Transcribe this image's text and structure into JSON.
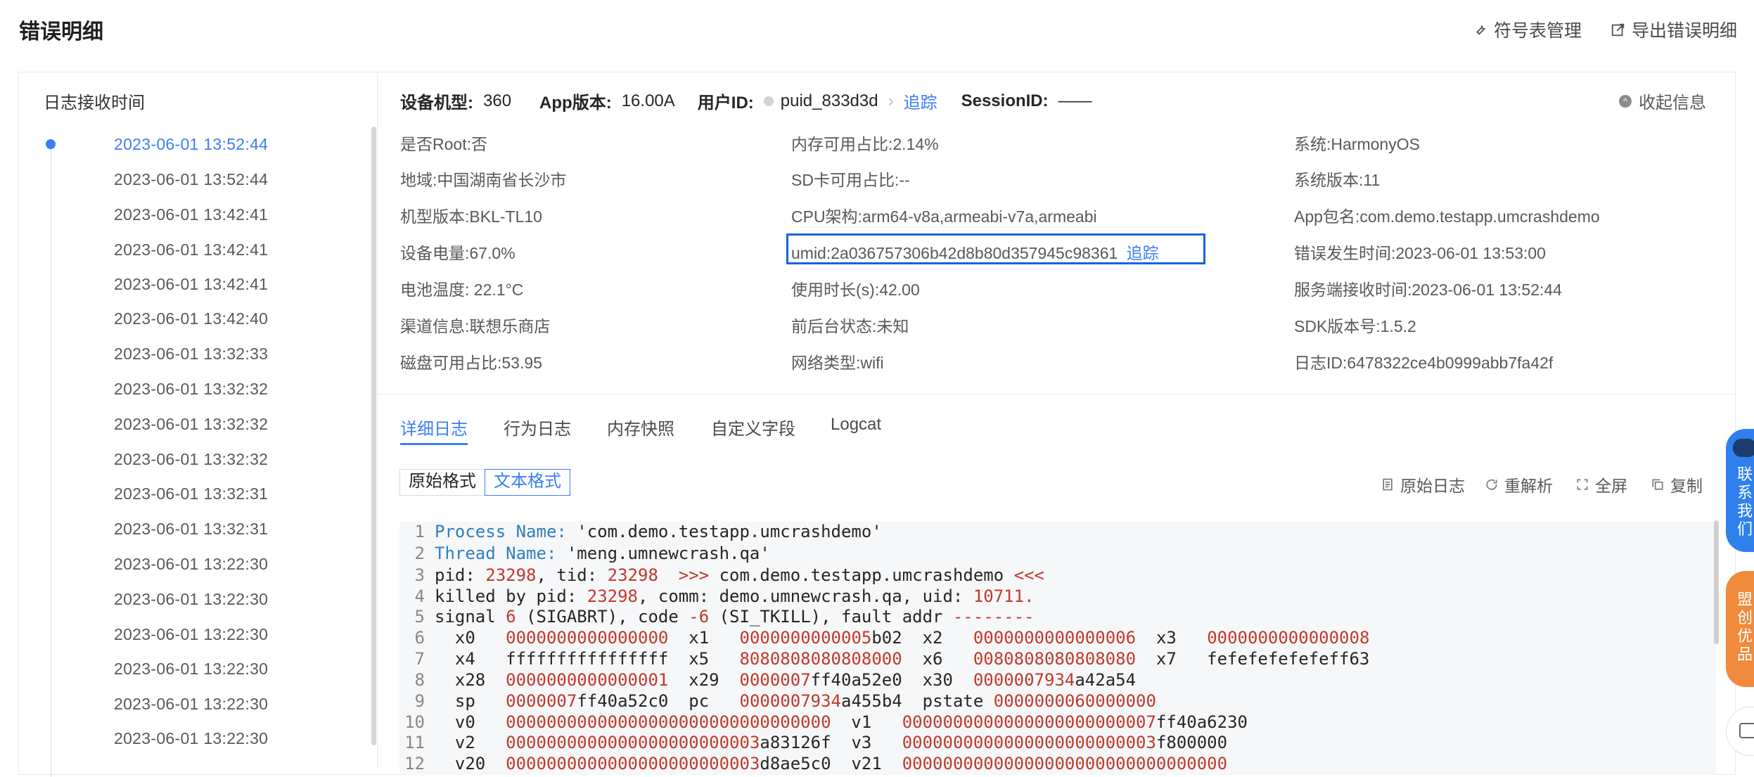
{
  "page": {
    "title": "错误明细",
    "symbol_mgmt": "符号表管理",
    "export": "导出错误明细"
  },
  "timeline": {
    "header": "日志接收时间",
    "items": [
      "2023-06-01 13:52:44",
      "2023-06-01 13:52:44",
      "2023-06-01 13:42:41",
      "2023-06-01 13:42:41",
      "2023-06-01 13:42:41",
      "2023-06-01 13:42:40",
      "2023-06-01 13:32:33",
      "2023-06-01 13:32:32",
      "2023-06-01 13:32:32",
      "2023-06-01 13:32:32",
      "2023-06-01 13:32:31",
      "2023-06-01 13:32:31",
      "2023-06-01 13:22:30",
      "2023-06-01 13:22:30",
      "2023-06-01 13:22:30",
      "2023-06-01 13:22:30",
      "2023-06-01 13:22:30",
      "2023-06-01 13:22:30"
    ]
  },
  "header": {
    "device_label": "设备机型:",
    "device_value": "360",
    "app_label": "App版本:",
    "app_value": "16.00A",
    "user_label": "用户ID:",
    "user_value": "puid_833d3d",
    "trace": "追踪",
    "session_label": "SessionID:",
    "session_value": "——",
    "collapse": "收起信息"
  },
  "info": {
    "col1": [
      "是否Root:否",
      "地域:中国湖南省长沙市",
      "机型版本:BKL-TL10",
      "设备电量:67.0%",
      "电池温度: 22.1°C",
      "渠道信息:联想乐商店",
      "磁盘可用占比:53.95"
    ],
    "col2": [
      "内存可用占比:2.14%",
      "SD卡可用占比:--",
      "CPU架构:arm64-v8a,armeabi-v7a,armeabi",
      "umid:2a036757306b42d8b80d357945c98361",
      "使用时长(s):42.00",
      "前后台状态:未知",
      "网络类型:wifi"
    ],
    "col3": [
      "系统:HarmonyOS",
      "系统版本:11",
      "App包名:com.demo.testapp.umcrashdemo",
      "错误发生时间:2023-06-01 13:53:00",
      "服务端接收时间:2023-06-01 13:52:44",
      "SDK版本号:1.5.2",
      "日志ID:6478322ce4b0999abb7fa42f"
    ],
    "umid_trace": "追踪"
  },
  "tabs": [
    "详细日志",
    "行为日志",
    "内存快照",
    "自定义字段",
    "Logcat"
  ],
  "format": {
    "raw": "原始格式",
    "text": "文本格式"
  },
  "tools": {
    "raw_log": "原始日志",
    "reparse": "重解析",
    "fullscreen": "全屏",
    "copy": "复制"
  },
  "code": {
    "line_numbers": [
      "1",
      "2",
      "3",
      "4",
      "5",
      "6",
      "7",
      "8",
      "9",
      "10",
      "11",
      "12"
    ],
    "l1": {
      "key": "Process Name:",
      "val": " 'com.demo.testapp.umcrashdemo'"
    },
    "l2": {
      "key": "Thread Name:",
      "val": " 'meng.umnewcrash.qa'"
    },
    "l3": {
      "a": "pid: ",
      "b": "23298",
      "c": ", tid: ",
      "d": "23298",
      "e": "  >>> ",
      "f": "com.demo.testapp.umcrashdemo",
      "g": " <<<"
    },
    "l4": {
      "a": "killed by pid: ",
      "b": "23298",
      "c": ", comm: demo.umnewcrash.qa, uid: ",
      "d": "10711."
    },
    "l5": {
      "a": "signal ",
      "b": "6",
      "c": " (SIGABRT), code ",
      "d": "-6",
      "e": " (SI_TKILL), fault addr ",
      "f": "--------"
    },
    "l6": {
      "a": "  x0   ",
      "b": "0000000000000000",
      "c": "  x1   ",
      "d": "0000000000005",
      "e": "b02",
      "f": "  x2   ",
      "g": "0000000000000006",
      "h": "  x3   ",
      "i": "0000000000000008"
    },
    "l7": {
      "a": "  x4   ffffffffffffffff  x5   ",
      "b": "8080808080808000",
      "c": "  x6   ",
      "d": "0080808080808080",
      "e": "  x7   fefefefefefeff63"
    },
    "l8": {
      "a": "  x28  ",
      "b": "0000000000000001",
      "c": "  x29  ",
      "d": "0000007",
      "e": "ff40a52e0",
      "f": "  x30  ",
      "g": "0000007934",
      "h": "a42a54"
    },
    "l9": {
      "a": "  sp   ",
      "b": "0000007",
      "c": "ff40a52c0",
      "d": "  pc   ",
      "e": "0000007934",
      "f": "a455b4",
      "g": "  pstate ",
      "h": "0000000060000000"
    },
    "l10": {
      "a": "  v0   ",
      "b": "00000000000000000000000000000000",
      "c": "  v1   ",
      "d": "0000000000000000000000007",
      "e": "ff40a6230"
    },
    "l11": {
      "a": "  v2   ",
      "b": "0000000000000000000000003",
      "c": "a83126f",
      "d": "  v3   ",
      "e": "0000000000000000000000003",
      "f": "f800000"
    },
    "l12": {
      "a": "  v20  ",
      "b": "0000000000000000000000003",
      "c": "d8ae5c0",
      "d": "  v21  ",
      "e": "00000000000000000000000000000000"
    }
  },
  "floating": {
    "contact": "联系我们",
    "promo": "盟创优品"
  }
}
